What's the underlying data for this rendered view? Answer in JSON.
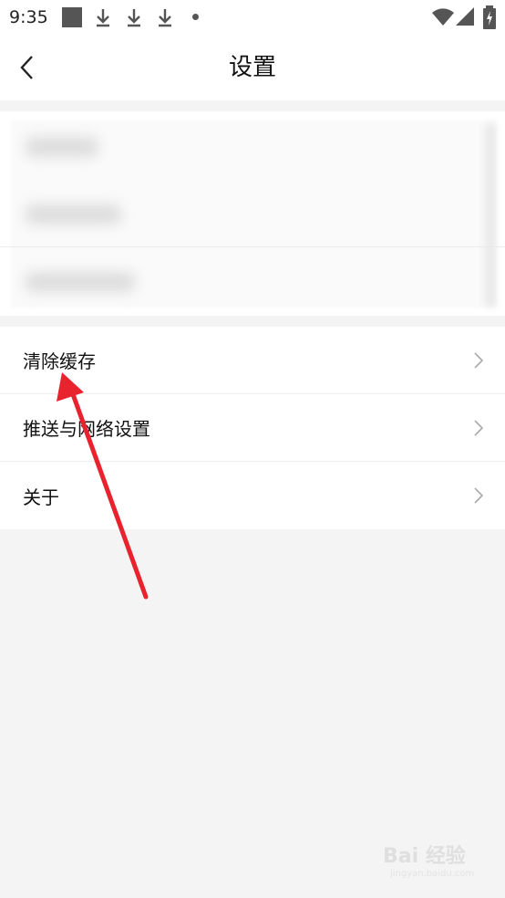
{
  "status_bar": {
    "time": "9:35",
    "icons": [
      "notification-square-icon",
      "download-icon",
      "download-icon",
      "download-icon",
      "dot-icon",
      "wifi-icon",
      "signal-icon",
      "battery-charging-icon"
    ]
  },
  "navbar": {
    "back_icon": "chevron-left-icon",
    "title": "设置"
  },
  "menu": {
    "items": [
      {
        "label": "清除缓存",
        "icon": "chevron-right-icon"
      },
      {
        "label": "推送与网络设置",
        "icon": "chevron-right-icon"
      },
      {
        "label": "关于",
        "icon": "chevron-right-icon"
      }
    ]
  },
  "colors": {
    "background": "#f4f4f4",
    "annotation_arrow": "#e8232e"
  },
  "watermark": {
    "brand": "Bai 经验",
    "url": "jingyan.baidu.com"
  }
}
